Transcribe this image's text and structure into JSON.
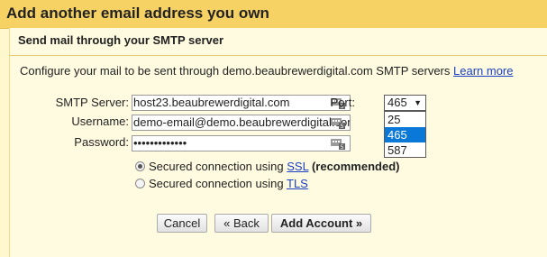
{
  "dialog": {
    "title": "Add another email address you own"
  },
  "panel": {
    "heading": "Send mail through your SMTP server",
    "description": "Configure your mail to be sent through demo.beaubrewerdigital.com SMTP servers",
    "learn_more": "Learn more"
  },
  "form": {
    "smtp_label": "SMTP Server:",
    "smtp_value": "host23.beaubrewerdigital.com",
    "port_label": "Port:",
    "port_selected": "465",
    "port_options": [
      "25",
      "465",
      "587"
    ],
    "username_label": "Username:",
    "username_value": "demo-email@demo.beaubrewerdigital.com",
    "password_label": "Password:",
    "password_value": "•••••••••••••",
    "ssl_text": "Secured connection using",
    "ssl_link": "SSL",
    "ssl_note": "(recommended)",
    "tls_text": "Secured connection using",
    "tls_link": "TLS",
    "selected_security": "SSL"
  },
  "buttons": {
    "cancel": "Cancel",
    "back": "« Back",
    "add": "Add Account »"
  },
  "icons": {
    "field_icon": "password-manager-icon"
  },
  "colors": {
    "title_bg": "#f6d164",
    "panel_bg": "#fffbe0",
    "link": "#1a3fc2",
    "selected_option": "#0a78d7"
  }
}
